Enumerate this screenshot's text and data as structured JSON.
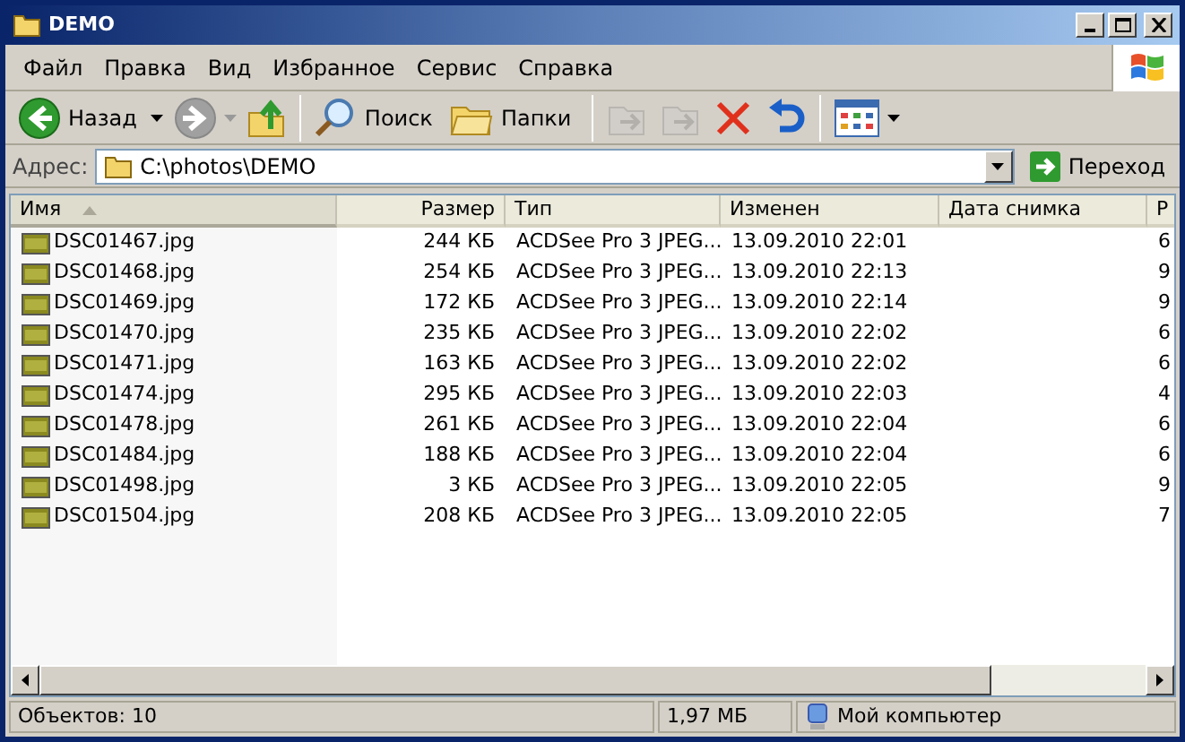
{
  "window": {
    "title": "DEMO"
  },
  "menu": [
    "Файл",
    "Правка",
    "Вид",
    "Избранное",
    "Сервис",
    "Справка"
  ],
  "toolbar": [
    {
      "kind": "back",
      "label": "Назад",
      "disabled": false
    },
    {
      "kind": "forward",
      "disabled": true
    },
    {
      "kind": "up",
      "disabled": false
    },
    {
      "kind": "search",
      "label": "Поиск",
      "disabled": false
    },
    {
      "kind": "folders",
      "label": "Папки",
      "disabled": false
    },
    {
      "kind": "move",
      "disabled": true
    },
    {
      "kind": "copy",
      "disabled": true
    },
    {
      "kind": "delete",
      "disabled": false
    },
    {
      "kind": "undo",
      "disabled": false
    },
    {
      "kind": "views",
      "disabled": false
    }
  ],
  "address": {
    "label": "Адрес:",
    "value": "C:\\photos\\DEMO",
    "go": "Переход"
  },
  "table": {
    "columns": [
      {
        "label": "Имя",
        "sorted": true
      },
      {
        "label": "Размер",
        "sorted": false
      },
      {
        "label": "Тип",
        "sorted": false
      },
      {
        "label": "Изменен",
        "sorted": false
      },
      {
        "label": "Дата снимка",
        "sorted": false
      },
      {
        "label": "Р",
        "sorted": false
      }
    ],
    "rows": [
      [
        "DSC01467.jpg",
        "244 КБ",
        "ACDSee Pro 3 JPEG...",
        "13.09.2010 22:01",
        "",
        "6"
      ],
      [
        "DSC01468.jpg",
        "254 КБ",
        "ACDSee Pro 3 JPEG...",
        "13.09.2010 22:13",
        "",
        "9"
      ],
      [
        "DSC01469.jpg",
        "172 КБ",
        "ACDSee Pro 3 JPEG...",
        "13.09.2010 22:14",
        "",
        "9"
      ],
      [
        "DSC01470.jpg",
        "235 КБ",
        "ACDSee Pro 3 JPEG...",
        "13.09.2010 22:02",
        "",
        "6"
      ],
      [
        "DSC01471.jpg",
        "163 КБ",
        "ACDSee Pro 3 JPEG...",
        "13.09.2010 22:02",
        "",
        "6"
      ],
      [
        "DSC01474.jpg",
        "295 КБ",
        "ACDSee Pro 3 JPEG...",
        "13.09.2010 22:03",
        "",
        "4"
      ],
      [
        "DSC01478.jpg",
        "261 КБ",
        "ACDSee Pro 3 JPEG...",
        "13.09.2010 22:04",
        "",
        "6"
      ],
      [
        "DSC01484.jpg",
        "188 КБ",
        "ACDSee Pro 3 JPEG...",
        "13.09.2010 22:04",
        "",
        "6"
      ],
      [
        "DSC01498.jpg",
        "3 КБ",
        "ACDSee Pro 3 JPEG...",
        "13.09.2010 22:05",
        "",
        "9"
      ],
      [
        "DSC01504.jpg",
        "208 КБ",
        "ACDSee Pro 3 JPEG...",
        "13.09.2010 22:05",
        "",
        "7"
      ]
    ]
  },
  "status_bar": {
    "objects": "Объектов: 10",
    "size": "1,97 МБ",
    "location": "Мой компьютер"
  }
}
